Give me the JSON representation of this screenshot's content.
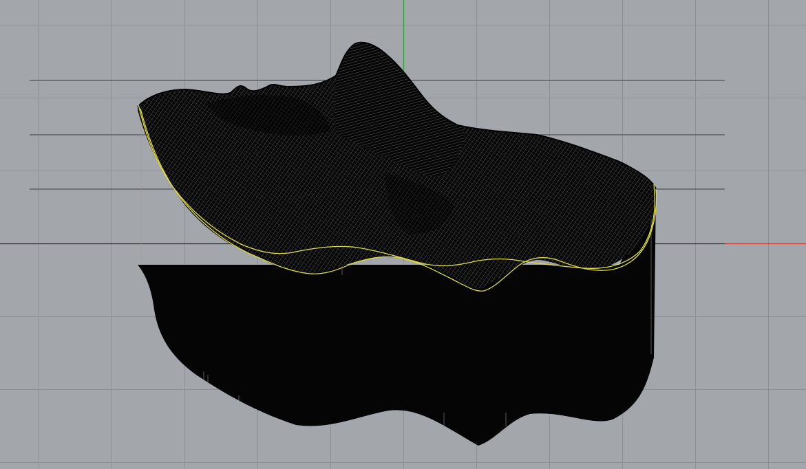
{
  "viewport": {
    "background": "#a3a6ab",
    "grid_minor_color": "#989ba0",
    "grid_major_color": "#8d9095",
    "x_axis_color": "#c8362a",
    "y_axis_color": "#2fa82f",
    "guide_line_color": "#3c3c3c",
    "mesh_fill": "#050505",
    "wire_color": "#9a9a9a",
    "curve_color": "#e0dc3c",
    "grid_visible": true
  },
  "scene": {
    "object_name": "face-relief-mesh",
    "display_mode": "wireframe-mesh",
    "section_curves": 2
  }
}
